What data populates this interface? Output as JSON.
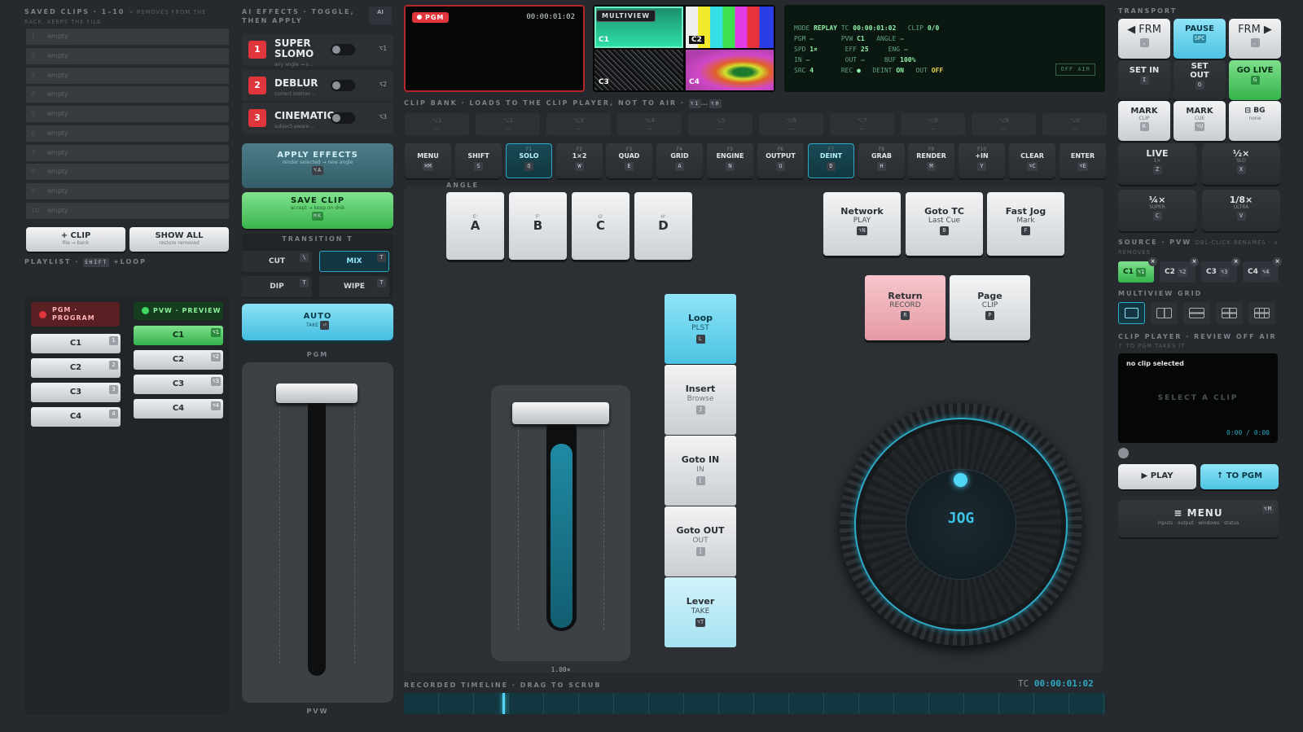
{
  "saved_clips": {
    "title": "SAVED CLIPS · 1–10",
    "note": "× REMOVES FROM THE RACK, KEEPS THE FILE",
    "slots": [
      {
        "n": "1",
        "label": "empty"
      },
      {
        "n": "2",
        "label": "empty"
      },
      {
        "n": "3",
        "label": "empty"
      },
      {
        "n": "4",
        "label": "empty"
      },
      {
        "n": "5",
        "label": "empty"
      },
      {
        "n": "6",
        "label": "empty"
      },
      {
        "n": "7",
        "label": "empty"
      },
      {
        "n": "8",
        "label": "empty"
      },
      {
        "n": "9",
        "label": "empty"
      },
      {
        "n": "10",
        "label": "empty"
      }
    ],
    "add_clip": "+ CLIP",
    "add_clip_sub": "file → bank",
    "show_all": "SHOW ALL",
    "show_all_sub": "restore removed"
  },
  "playlist": {
    "title": "PLAYLIST ·",
    "shortcut": "SHIFT",
    "suffix": "+LOOP",
    "pgm_label": "PGM · PROGRAM",
    "pvw_label": "PVW · PREVIEW",
    "pgm_items": [
      {
        "label": "C1",
        "key": "1"
      },
      {
        "label": "C2",
        "key": "2"
      },
      {
        "label": "C3",
        "key": "3"
      },
      {
        "label": "C4",
        "key": "4"
      }
    ],
    "pvw_items": [
      {
        "label": "C1",
        "key": "⌥1"
      },
      {
        "label": "C2",
        "key": "⌥2"
      },
      {
        "label": "C3",
        "key": "⌥3"
      },
      {
        "label": "C4",
        "key": "⌥4"
      }
    ]
  },
  "ai_effects": {
    "title": "AI EFFECTS · TOGGLE, THEN APPLY",
    "badge": "AI",
    "items": [
      {
        "num": "1",
        "name_1": "SUPER",
        "name_2": "SLOMO",
        "sub": "any angle → s...",
        "key": "⌥1"
      },
      {
        "num": "2",
        "name_1": "DEBLUR",
        "name_2": "",
        "sub": "correct motion ...",
        "key": "⌥2"
      },
      {
        "num": "3",
        "name_1": "CINEMATIC",
        "name_2": "",
        "sub": "subject-aware ...",
        "key": "⌥3"
      }
    ],
    "apply": "APPLY EFFECTS",
    "apply_sub": "render selected → new angle",
    "apply_key": "⌥A",
    "save": "SAVE CLIP",
    "save_sub": "accept → keep on disk",
    "save_key": "⌘K",
    "transition_label": "TRANSITION",
    "transition_key": "T",
    "cut": "CUT",
    "cut_key": "\\",
    "mix": "MIX",
    "mix_key": "T",
    "dip": "DIP",
    "dip_key": "T",
    "wipe": "WIPE",
    "wipe_key": "T",
    "auto": "AUTO",
    "auto_sub": "TAKE",
    "auto_key": "⏎",
    "fader_top": "PGM",
    "fader_bottom": "PVW"
  },
  "monitors": {
    "pgm_tag": "PGM",
    "pgm_tc": "00:00:01:02",
    "multiview_tag": "MULTIVIEW",
    "cells": [
      "C1",
      "C2",
      "C3",
      "C4"
    ],
    "status": {
      "mode_k": "MODE",
      "mode_v": "REPLAY",
      "tc_k": "TC",
      "tc_v": "00:00:01:02",
      "clip_k": "CLIP",
      "clip_v": "0/0",
      "pgm_k": "PGM",
      "pgm_v": "—",
      "pvw_k": "PVW",
      "pvw_v": "C1",
      "angle_k": "ANGLE",
      "angle_v": "—",
      "spd_k": "SPD",
      "spd_v": "1×",
      "eff_k": "EFF",
      "eff_v": "25",
      "eng_k": "ENG",
      "eng_v": "—",
      "in_k": "IN",
      "in_v": "—",
      "out_k": "OUT",
      "out_v": "—",
      "buf_k": "BUF",
      "buf_v": "100%",
      "src_k": "SRC",
      "src_v": "4",
      "rec_k": "REC",
      "rec_v": "●",
      "deint_k": "DEINT",
      "deint_v": "ON",
      "out2_k": "OUT",
      "out2_v": "OFF",
      "air": "OFF AIR"
    }
  },
  "clip_bank": {
    "title": "CLIP BANK · LOADS TO THE CLIP PLAYER, NOT TO AIR ·",
    "range_a": "⌥1",
    "range_b": "⌥0",
    "slots": [
      {
        "key": "⌥1",
        "label": "—"
      },
      {
        "key": "⌥2",
        "label": "—"
      },
      {
        "key": "⌥3",
        "label": "—"
      },
      {
        "key": "⌥4",
        "label": "—"
      },
      {
        "key": "⌥5",
        "label": "—"
      },
      {
        "key": "⌥6",
        "label": "—"
      },
      {
        "key": "⌥7",
        "label": "—"
      },
      {
        "key": "⌥8",
        "label": "—"
      },
      {
        "key": "⌥9",
        "label": "—"
      },
      {
        "key": "⌥0",
        "label": "—"
      }
    ]
  },
  "function_keys": [
    {
      "f": "",
      "label": "MENU",
      "key": "⌘M",
      "active": false
    },
    {
      "f": "",
      "label": "SHIFT",
      "key": "S",
      "active": false
    },
    {
      "f": "F1",
      "label": "SOLO",
      "key": "Q",
      "active": true
    },
    {
      "f": "F2",
      "label": "1×2",
      "key": "W",
      "active": false
    },
    {
      "f": "F3",
      "label": "QUAD",
      "key": "E",
      "active": false
    },
    {
      "f": "F4",
      "label": "GRID",
      "key": "A",
      "active": false
    },
    {
      "f": "F5",
      "label": "ENGINE",
      "key": "N",
      "active": false
    },
    {
      "f": "F6",
      "label": "OUTPUT",
      "key": "U",
      "active": false
    },
    {
      "f": "F7",
      "label": "DEINT",
      "key": "D",
      "active": true
    },
    {
      "f": "F8",
      "label": "GRAB",
      "key": "H",
      "active": false
    },
    {
      "f": "F9",
      "label": "RENDER",
      "key": "M",
      "active": false
    },
    {
      "f": "F10",
      "label": "+IN",
      "key": "Y",
      "active": false
    },
    {
      "f": "",
      "label": "CLEAR",
      "key": "⌥C",
      "active": false
    },
    {
      "f": "",
      "label": "ENTER",
      "key": "⌥E",
      "active": false
    }
  ],
  "angle": {
    "title": "ANGLE",
    "keys": [
      {
        "sup": "E'",
        "label": "A"
      },
      {
        "sup": "F'",
        "label": "B"
      },
      {
        "sup": "G'",
        "label": "C"
      },
      {
        "sup": "H'",
        "label": "D"
      }
    ]
  },
  "controls": {
    "network": "Network",
    "network_sub": "PLAY",
    "network_key": "⌥N",
    "goto_tc": "Goto TC",
    "goto_tc_sub": "Last Cue",
    "goto_tc_key": "B",
    "fast_jog": "Fast Jog",
    "fast_jog_sub": "Mark",
    "fast_jog_key": "F",
    "return": "Return",
    "return_sub": "RECORD",
    "return_key": "R",
    "page": "Page",
    "page_sub": "CLIP",
    "page_key": "P",
    "side": [
      {
        "label": "Loop",
        "sub": "PLST",
        "key": "L"
      },
      {
        "label": "Insert",
        "sub": "Browse",
        "key": "J"
      },
      {
        "label": "Goto IN",
        "sub": "IN",
        "key": "["
      },
      {
        "label": "Goto OUT",
        "sub": "OUT",
        "key": "]"
      },
      {
        "label": "Lever",
        "sub": "TAKE",
        "key": "⌥T"
      }
    ],
    "speed": "1.00×",
    "jog": "JOG"
  },
  "timeline": {
    "title": "RECORDED TIMELINE · DRAG TO SCRUB",
    "tc_label": "TC",
    "tc": "00:00:01:02",
    "progress": 0.14
  },
  "transport": {
    "title": "TRANSPORT",
    "frm_back": "◀ FRM",
    "frm_back_key": ",",
    "pause": "PAUSE",
    "pause_key": "SPC",
    "frm_fwd": "FRM ▶",
    "frm_fwd_key": ".",
    "set_in": "SET IN",
    "set_in_key": "I",
    "set_out_1": "SET",
    "set_out_2": "OUT",
    "set_out_key": "O",
    "go_live": "GO LIVE",
    "go_live_key": "G",
    "mark_clip": "MARK",
    "mark_clip_sub": "CLIP",
    "mark_clip_key": "K",
    "mark_cue": "MARK",
    "mark_cue_sub": "CUE",
    "mark_cue_key": "⌥U",
    "bg": "⊟ BG",
    "bg_sub": "none",
    "live": "LIVE",
    "live_sub": "1×",
    "live_key": "Z",
    "slo": "½×",
    "slo_sub": "SLO",
    "slo_key": "X",
    "super": "¼×",
    "super_sub": "SUPER",
    "super_key": "C",
    "ultra": "1/8×",
    "ultra_sub": "ULTRA",
    "ultra_key": "V"
  },
  "source": {
    "title": "SOURCE · PVW",
    "note": "DBL-CLICK RENAMES · × REMOVES",
    "items": [
      {
        "label": "C1",
        "key": "⌥1"
      },
      {
        "label": "C2",
        "key": "⌥2"
      },
      {
        "label": "C3",
        "key": "⌥3"
      },
      {
        "label": "C4",
        "key": "⌥4"
      }
    ]
  },
  "multiview_grid": {
    "title": "MULTIVIEW GRID"
  },
  "clip_player": {
    "title": "CLIP PLAYER · REVIEW OFF AIR",
    "note": "↑ TO PGM TAKES IT",
    "status": "no clip selected",
    "placeholder": "SELECT A CLIP",
    "time": "0:00 / 0:00",
    "play": "▶ PLAY",
    "to_pgm": "↑ TO PGM"
  },
  "menu": {
    "label": "≡ MENU",
    "sub": "inputs · output · windows · status",
    "key": "⌥M"
  },
  "colors": {
    "accent": "#2ea9c3",
    "pgm_red": "#e0353b",
    "pvw_green": "#35b34b",
    "background": "#26292d"
  }
}
